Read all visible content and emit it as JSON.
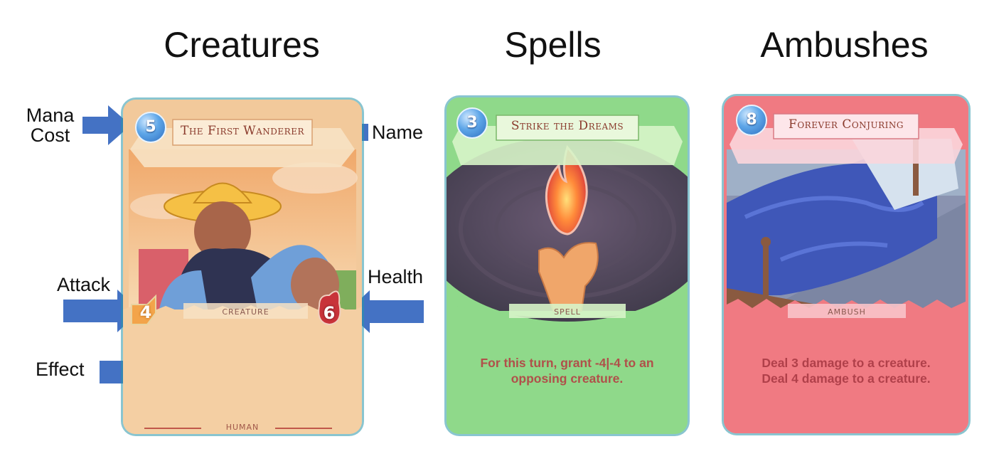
{
  "headings": {
    "creatures": "Creatures",
    "spells": "Spells",
    "ambushes": "Ambushes"
  },
  "annotations": {
    "mana_line1": "Mana",
    "mana_line2": "Cost",
    "name": "Name",
    "attack": "Attack",
    "health": "Health",
    "effect": "Effect"
  },
  "colors": {
    "arrow": "#4472c4",
    "creature_card": "#f2c99b",
    "spell_card": "#8fd98a",
    "ambush_card": "#f07a82",
    "card_text": "#a0463a"
  },
  "cards": {
    "creature": {
      "mana": "5",
      "name": "The First Wanderer",
      "type": "CREATURE",
      "attack": "4",
      "health": "6",
      "tribe": "HUMAN",
      "effect": ""
    },
    "spell": {
      "mana": "3",
      "name": "Strike the Dreams",
      "type": "SPELL",
      "effect_line1": "For this turn, grant -4|-4 to an",
      "effect_line2": "opposing creature."
    },
    "ambush": {
      "mana": "8",
      "name": "Forever Conjuring",
      "type": "AMBUSH",
      "effect_line1": "Deal 3 damage to a creature.",
      "effect_line2": "Deal 4 damage to a creature."
    }
  }
}
